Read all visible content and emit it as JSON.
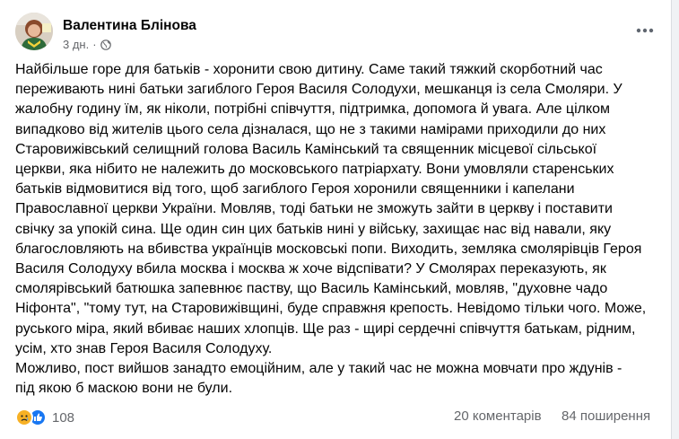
{
  "post": {
    "author": "Валентина Блінова",
    "time": "3 дн.",
    "time_separator": "·",
    "privacy_icon": "globe-icon",
    "more_icon": "more-options-icon",
    "text_lines": [
      "Найбільше горе для батьків - хоронити свою дитину. Саме такий тяжкий скорботний час",
      "переживають нині батьки загиблого Героя Василя Солодухи, мешканця із села Смоляри. У",
      "жалобну годину їм, як ніколи, потрібні співчуття, підтримка, допомога й увага. Але цілком",
      "випадково від жителів цього села дізналася, що не з такими намірами приходили до них",
      "Старовижівський селищний голова Василь Камінський  та священник місцевої сільської",
      "церкви, яка нібито не належить до московського патріархату. Вони умовляли старенських",
      "батьків відмовитися від того, щоб загиблого Героя хоронили священники і капелани",
      "Православної церкви України. Мовляв, тоді батьки не зможуть зайти в церкву і поставити",
      "свічку за упокій сина. Ще один син цих батьків нині у війську, захищає нас від навали, яку",
      "благословляють на вбивства українців московські попи. Виходить, земляка смолярівців Героя",
      "Василя Солодуху вбила москва і москва ж хоче відспівати? У Смолярах переказують, як",
      "смолярівський батюшка запевнює паству, що Василь Камінський, мовляв, \"духовне чадо",
      "Ніфонта\", \"тому тут, на Старовижівщині, буде справжня крепость. Невідомо тільки чого. Може,",
      "руського міра, який вбиває наших хлопців.  Ще раз - щирі сердечні співчуття батькам, рідним,",
      "усім, хто знав Героя Василя Солодуху.",
      "Можливо, пост вийшов занадто емоційним, але у такий час не можна мовчати про ждунів -",
      "під якою б маскою вони не були."
    ]
  },
  "footer": {
    "reaction_icons": [
      "sad-reaction-icon",
      "like-reaction-icon"
    ],
    "reaction_count": "108",
    "comments": "20 коментарів",
    "shares": "84 поширення"
  },
  "colors": {
    "text": "#050505",
    "secondary": "#65676b",
    "like": "#1877f2",
    "sad": "#f7b125"
  }
}
